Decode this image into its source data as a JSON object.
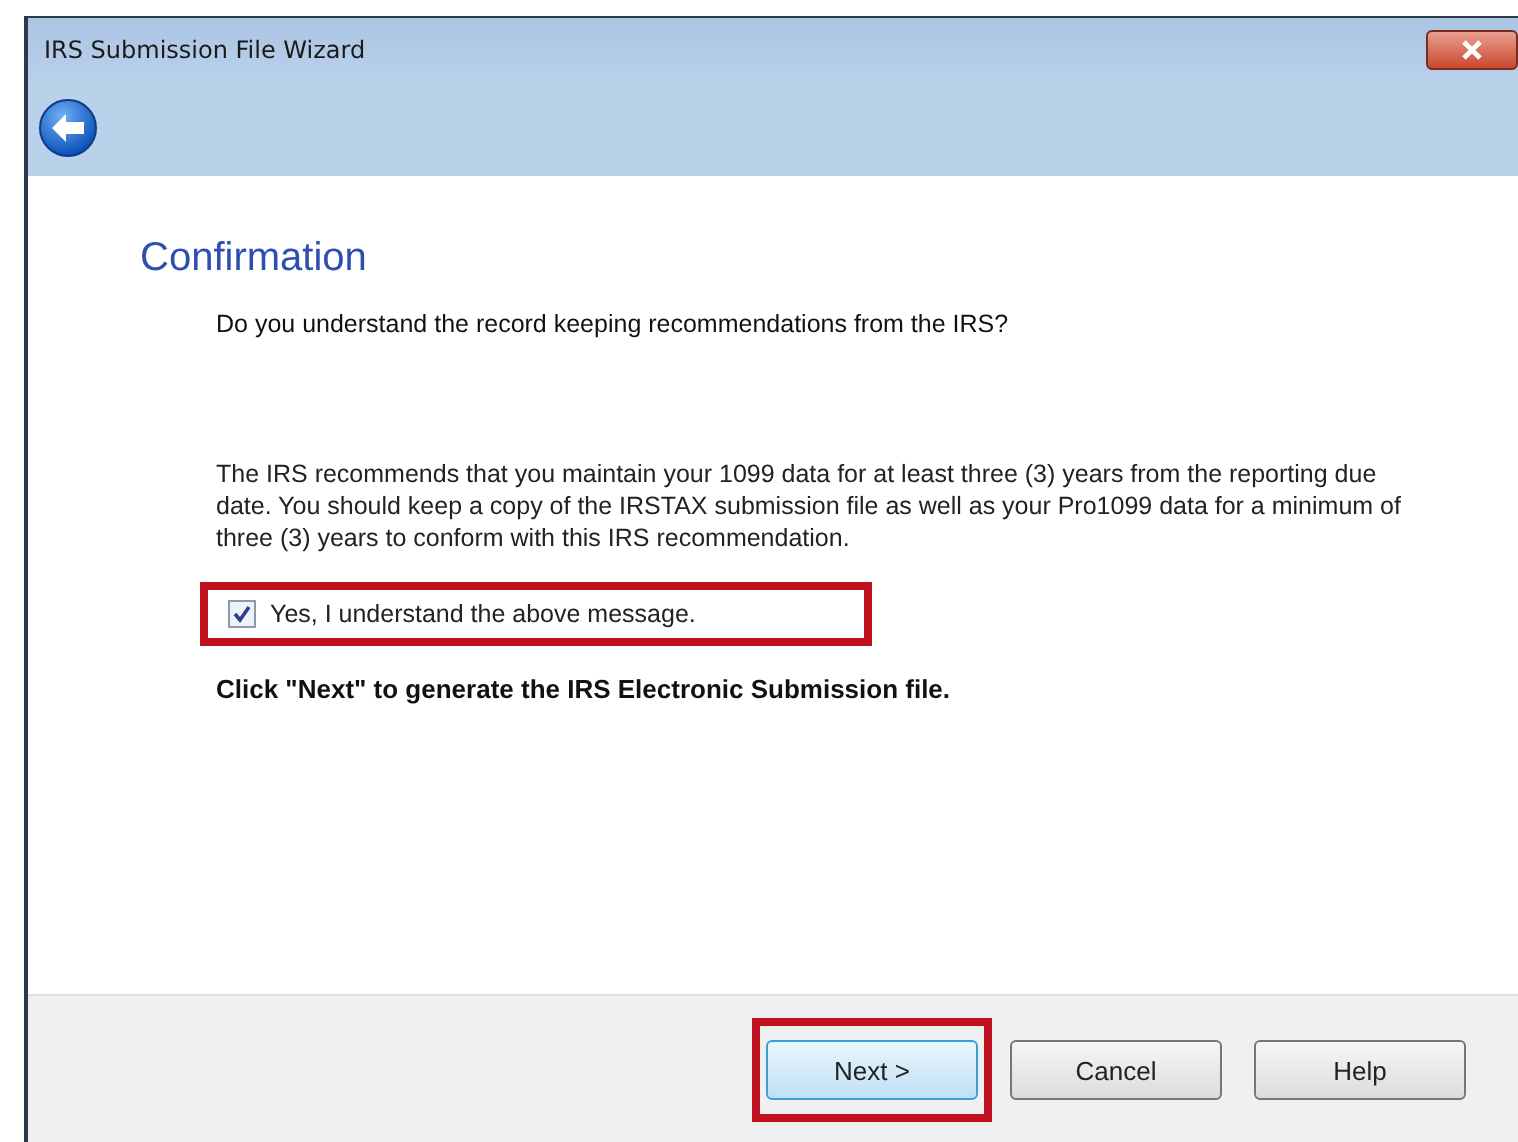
{
  "window": {
    "title": "IRS Submission File Wizard"
  },
  "heading": "Confirmation",
  "question": "Do you understand the record keeping recommendations from the IRS?",
  "message": "The IRS recommends that you maintain your 1099 data for at least three (3) years from the reporting due date. You should keep a copy of the IRSTAX submission file as well as your Pro1099 data for a minimum of three (3) years to conform with this IRS recommendation.",
  "confirm": {
    "label": "Yes, I understand the above message.",
    "checked": true,
    "highlighted": true
  },
  "instruction": "Click \"Next\" to generate the IRS Electronic Submission file.",
  "buttons": [
    {
      "label": "Next >",
      "default": true,
      "highlighted": true
    },
    {
      "label": "Cancel",
      "default": false,
      "highlighted": false
    },
    {
      "label": "Help",
      "default": false,
      "highlighted": false
    }
  ]
}
